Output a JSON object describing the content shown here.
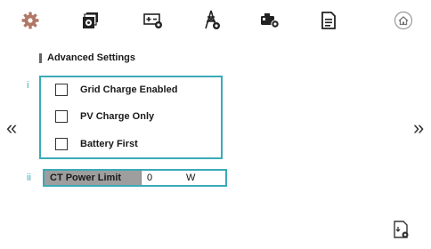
{
  "toolbar": {
    "items": [
      {
        "icon": "gear-icon"
      },
      {
        "icon": "stack-settings-icon"
      },
      {
        "icon": "battery-settings-icon"
      },
      {
        "icon": "grid-tower-settings-icon"
      },
      {
        "icon": "generator-settings-icon"
      },
      {
        "icon": "document-icon"
      },
      {
        "icon": "home-icon"
      }
    ]
  },
  "section": {
    "title": "Advanced Settings"
  },
  "markers": {
    "first": "i",
    "second": "ii"
  },
  "options": [
    {
      "label": "Grid Charge Enabled",
      "checked": false
    },
    {
      "label": "PV Charge Only",
      "checked": false
    },
    {
      "label": "Battery First",
      "checked": false
    }
  ],
  "ct_power_limit": {
    "label": "CT Power Limit",
    "value": "0",
    "unit": "W"
  },
  "nav": {
    "prev": "«",
    "next": "»"
  },
  "colors": {
    "accent": "#3aaab8",
    "gear": "#b07868"
  }
}
